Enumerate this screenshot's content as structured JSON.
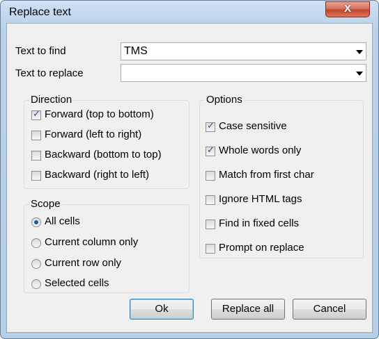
{
  "window": {
    "title": "Replace text",
    "close_glyph": "X"
  },
  "fields": {
    "find": {
      "label": "Text to find",
      "value": "TMS"
    },
    "replace": {
      "label": "Text to replace",
      "value": ""
    }
  },
  "direction": {
    "title": "Direction",
    "items": [
      {
        "label": "Forward (top to bottom)",
        "checked": true
      },
      {
        "label": "Forward (left to right)",
        "checked": false
      },
      {
        "label": "Backward (bottom to top)",
        "checked": false
      },
      {
        "label": "Backward (right to left)",
        "checked": false
      }
    ]
  },
  "scope": {
    "title": "Scope",
    "items": [
      {
        "label": "All cells",
        "selected": true
      },
      {
        "label": "Current column only",
        "selected": false
      },
      {
        "label": "Current row only",
        "selected": false
      },
      {
        "label": "Selected cells",
        "selected": false
      }
    ]
  },
  "options": {
    "title": "Options",
    "items": [
      {
        "label": "Case sensitive",
        "checked": true
      },
      {
        "label": "Whole words only",
        "checked": true
      },
      {
        "label": "Match from first char",
        "checked": false
      },
      {
        "label": "Ignore HTML tags",
        "checked": false
      },
      {
        "label": "Find in fixed cells",
        "checked": false
      },
      {
        "label": "Prompt on replace",
        "checked": false
      }
    ]
  },
  "buttons": {
    "ok": "Ok",
    "replace_all": "Replace all",
    "cancel": "Cancel"
  }
}
